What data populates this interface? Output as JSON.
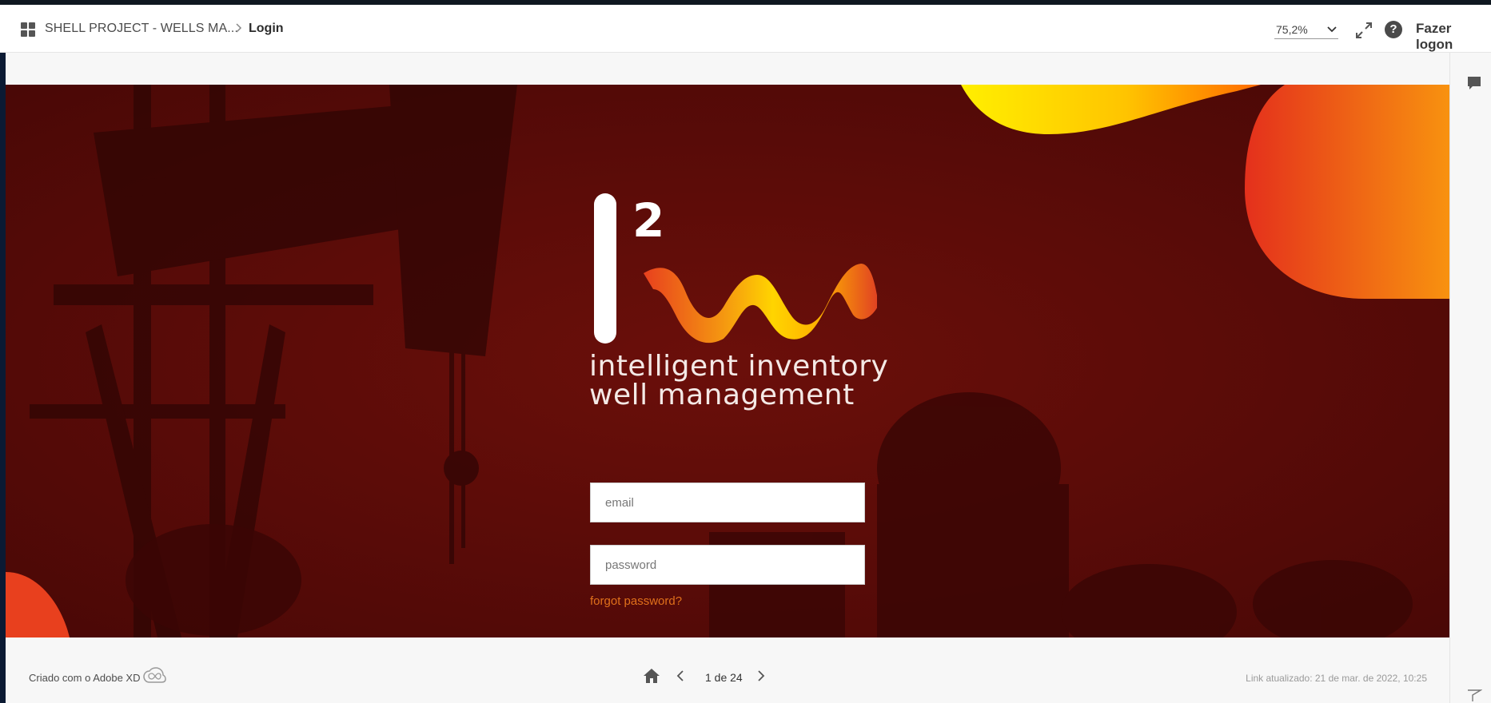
{
  "header": {
    "project_name": "SHELL PROJECT - WELLS MA...",
    "current_page": "Login",
    "zoom_level": "75,2%",
    "login_label": "Fazer logon"
  },
  "login": {
    "logo_mark": "I²wm",
    "tagline_line1": "intelligent inventory",
    "tagline_line2": "well management",
    "email_placeholder": "email",
    "password_placeholder": "password",
    "forgot_password": "forgot password?"
  },
  "footer": {
    "created_with": "Criado com o Adobe XD",
    "page_indicator": "1 de 24",
    "link_updated": "Link atualizado: 21 de mar. de 2022, 10:25"
  },
  "colors": {
    "background_red": "#5e0b08",
    "accent_orange": "#e0701b",
    "accent_yellow": "#ffd400"
  },
  "icons": {
    "apps": "grid-icon",
    "breadcrumb_separator": "chevron-right-icon",
    "zoom_dropdown": "chevron-down-icon",
    "fullscreen": "expand-icon",
    "help": "help-icon",
    "comments": "comment-icon",
    "creative_cloud": "creative-cloud-icon",
    "home": "home-icon",
    "previous": "chevron-left-icon",
    "next": "chevron-right-icon",
    "flag": "flag-icon"
  }
}
